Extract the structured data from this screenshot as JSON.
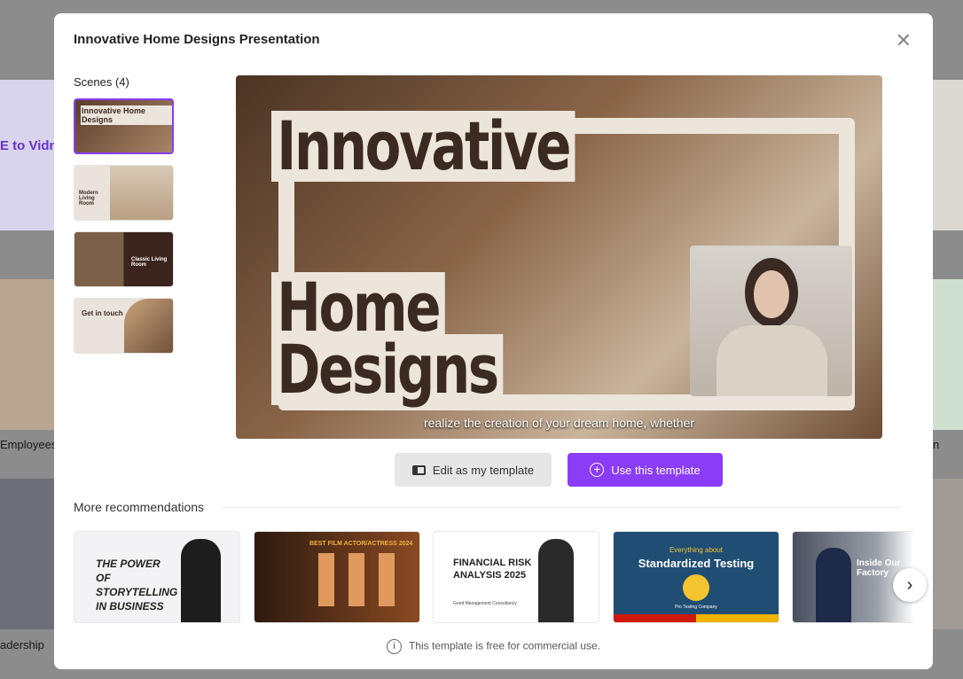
{
  "background": {
    "fragments": [
      "E to Vidn",
      "Employees",
      "adership",
      "n"
    ]
  },
  "modal": {
    "title": "Innovative Home Designs Presentation",
    "close_icon": "close-icon",
    "scenes_label": "Scenes (4)",
    "scenes": [
      {
        "label": "Innovative Home Designs"
      },
      {
        "label": "Modern Living Room"
      },
      {
        "label": "Classic Living Room"
      },
      {
        "label": "Get in touch"
      }
    ],
    "preview": {
      "line1": "Innovative",
      "line2": "Home",
      "line3": "Designs",
      "caption": "realize the creation of your dream home, whether"
    },
    "edit_button": "Edit as my template",
    "use_button": "Use this template",
    "accent_color": "#8b3cf7",
    "more_label": "More recommendations",
    "recommendations": [
      {
        "title": "THE POWER OF STORYTELLING IN BUSINESS"
      },
      {
        "title": "BEST FILM ACTOR/ACTRESS 2024"
      },
      {
        "title": "FINANCIAL RISK ANALYSIS 2025",
        "subtitle": "Good Management Consultancy"
      },
      {
        "title": "Standardized Testing",
        "kicker": "Everything about",
        "subtitle": "Pro Testing Company"
      },
      {
        "title": "Inside Our Factory"
      }
    ],
    "note": "This template is free for commercial use."
  }
}
